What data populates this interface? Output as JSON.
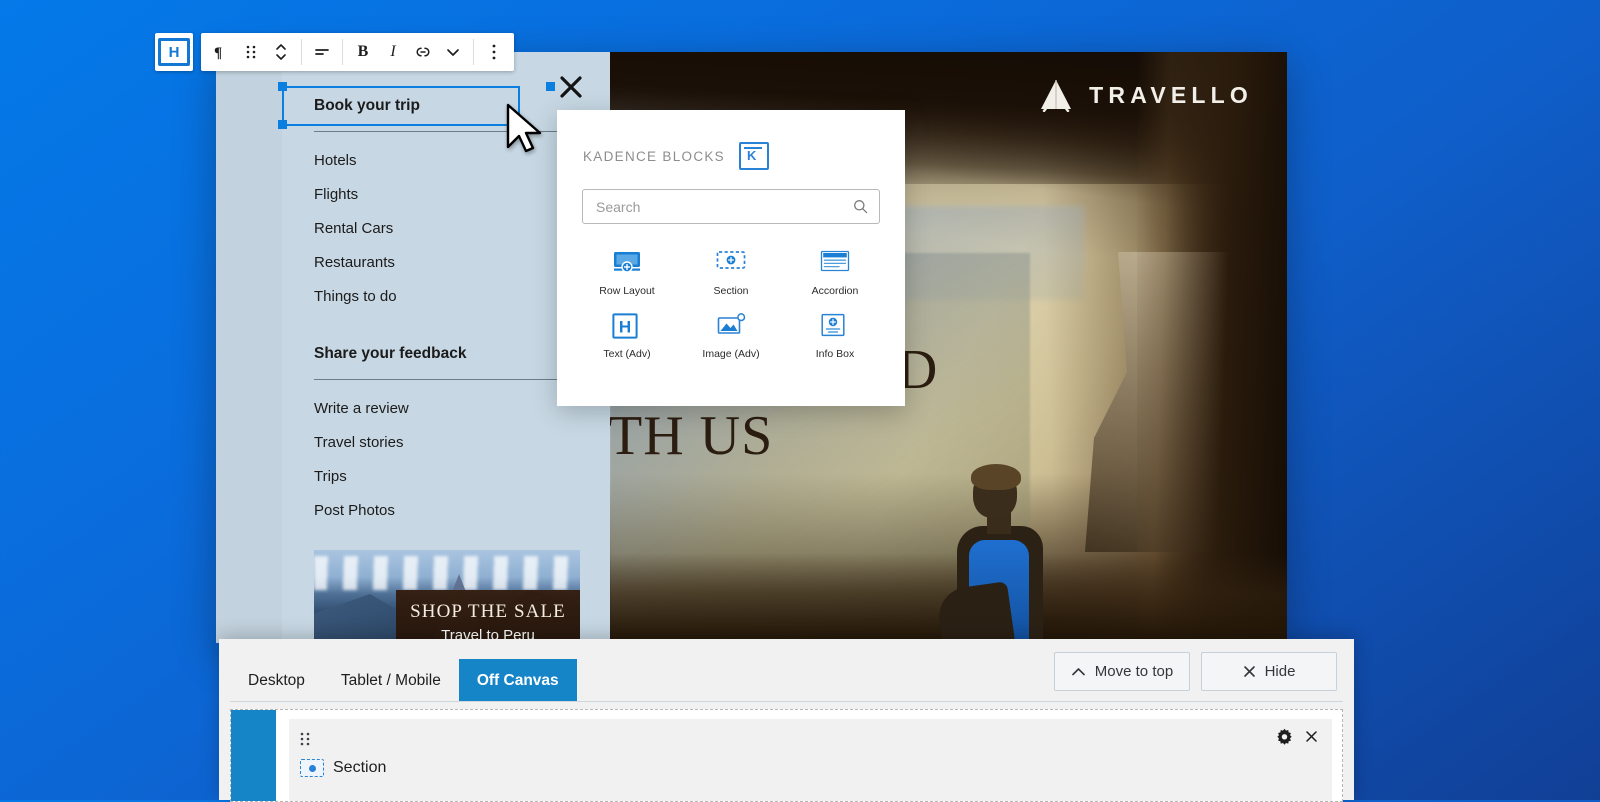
{
  "editor": {
    "logo_letter": "H",
    "toolbar": {
      "paragraph_icon": "paragraph-icon",
      "drag_icon": "drag-handle-icon",
      "move_icon": "move-up-down-icon",
      "align_icon": "align-left-icon",
      "bold_label": "B",
      "italic_label": "I",
      "link_icon": "link-icon",
      "more_formats_icon": "chevron-down-icon",
      "options_icon": "more-options-icon"
    }
  },
  "offcanvas": {
    "close_icon": "close-icon",
    "groups": [
      {
        "heading": "Book your trip",
        "items": [
          "Hotels",
          "Flights",
          "Rental Cars",
          "Restaurants",
          "Things to do"
        ]
      },
      {
        "heading": "Share your feedback",
        "items": [
          "Write a review",
          "Travel stories",
          "Trips",
          "Post Photos"
        ]
      }
    ],
    "promo": {
      "title": "SHOP THE  SALE",
      "subtitle": "Travel to Peru"
    }
  },
  "site": {
    "brand": "TRAVELLO",
    "brand_icon": "tent-icon",
    "hero_line1": "WORLD",
    "hero_line2": "TH US"
  },
  "kadence": {
    "title": "KADENCE BLOCKS",
    "logo_icon": "kadence-logo-icon",
    "search": {
      "placeholder": "Search",
      "value": "",
      "icon": "search-icon"
    },
    "blocks": [
      {
        "label": "Row Layout",
        "icon": "row-layout-icon"
      },
      {
        "label": "Section",
        "icon": "section-icon"
      },
      {
        "label": "Accordion",
        "icon": "accordion-icon"
      },
      {
        "label": "Text (Adv)",
        "icon": "advanced-text-icon"
      },
      {
        "label": "Image (Adv)",
        "icon": "advanced-image-icon"
      },
      {
        "label": "Info Box",
        "icon": "info-box-icon"
      }
    ]
  },
  "bottom_panel": {
    "tabs": [
      {
        "label": "Desktop",
        "active": false
      },
      {
        "label": "Tablet / Mobile",
        "active": false
      },
      {
        "label": "Off Canvas",
        "active": true
      }
    ],
    "actions": [
      {
        "label": "Move to top",
        "icon": "chevron-up-icon"
      },
      {
        "label": "Hide",
        "icon": "close-icon"
      }
    ],
    "row": {
      "drag_icon": "drag-handle-icon",
      "settings_icon": "gear-icon",
      "remove_icon": "close-icon",
      "block_label": "Section",
      "block_icon": "section-icon"
    }
  },
  "colors": {
    "accent_blue": "#1585c8",
    "toolbar_blue": "#1278d4",
    "selection_blue": "#0a7fe0",
    "background_from": "#0479e8",
    "background_to": "#113f96"
  }
}
